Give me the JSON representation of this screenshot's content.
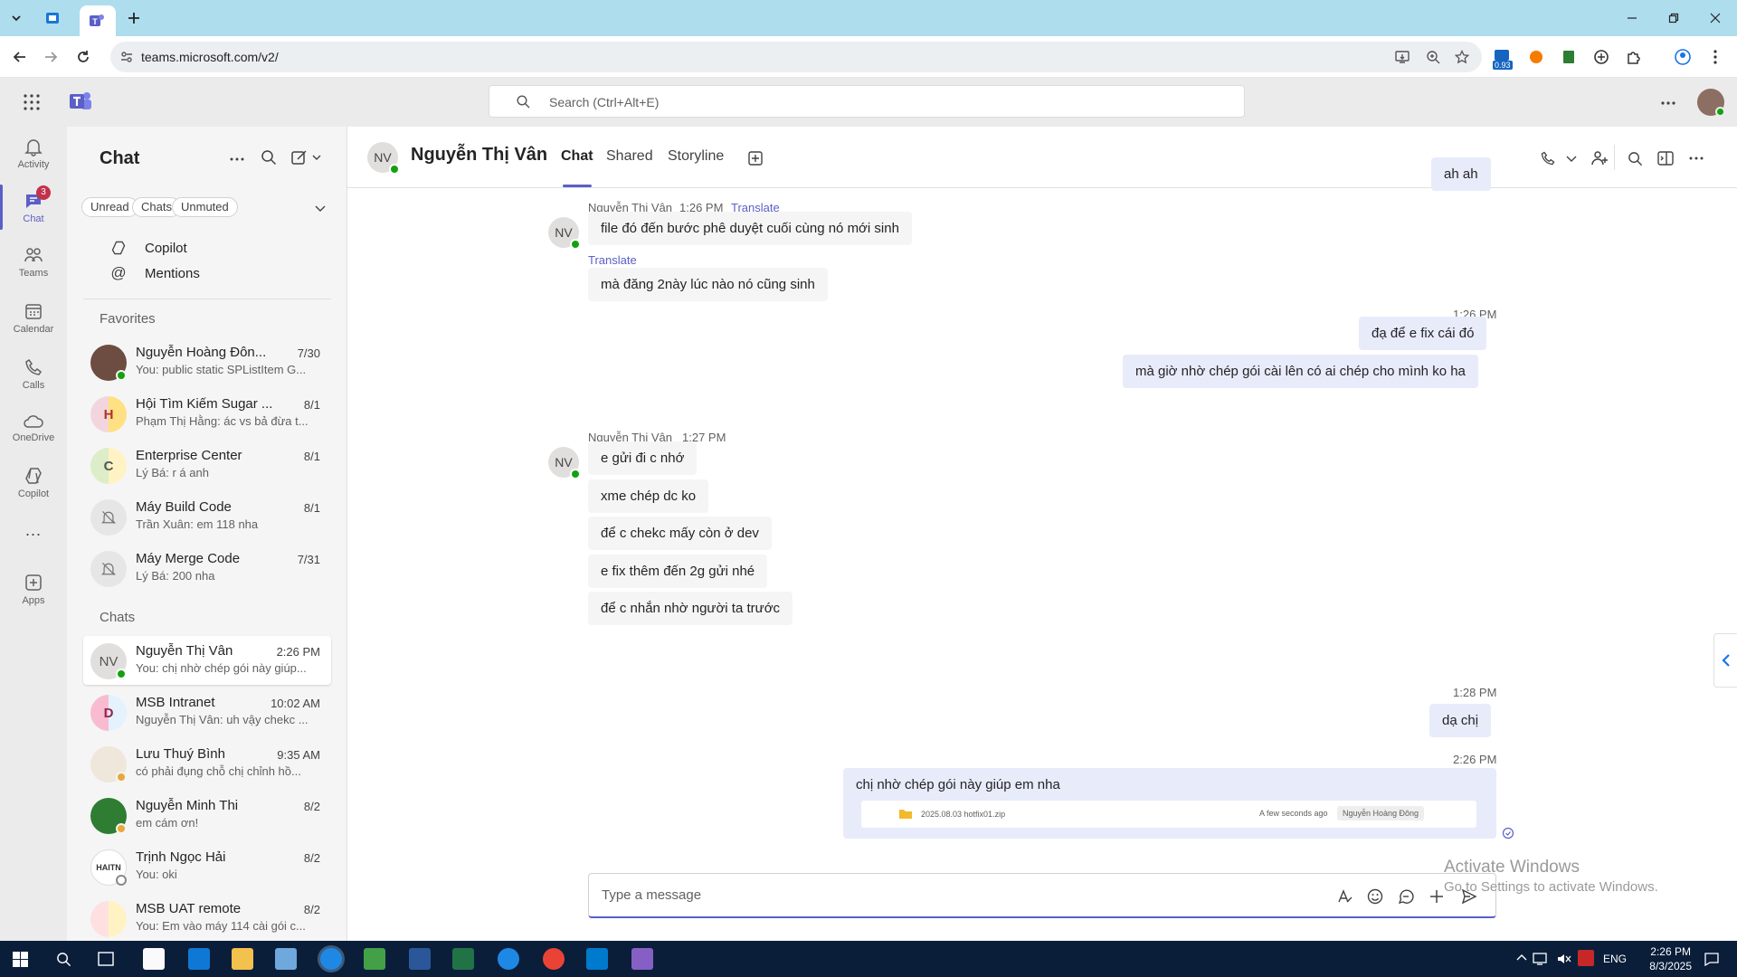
{
  "browser": {
    "url": "teams.microsoft.com/v2/",
    "ext_badge": "0.93"
  },
  "teams": {
    "search_placeholder": "Search (Ctrl+Alt+E)"
  },
  "rail": {
    "items": [
      {
        "label": "Activity",
        "icon": "bell-icon"
      },
      {
        "label": "Chat",
        "icon": "chat-icon",
        "badge": "3"
      },
      {
        "label": "Teams",
        "icon": "teams-icon"
      },
      {
        "label": "Calendar",
        "icon": "calendar-icon"
      },
      {
        "label": "Calls",
        "icon": "phone-icon"
      },
      {
        "label": "OneDrive",
        "icon": "cloud-icon"
      },
      {
        "label": "Copilot",
        "icon": "copilot-icon"
      },
      {
        "label": "...",
        "icon": "more-icon"
      },
      {
        "label": "Apps",
        "icon": "add-app-icon"
      }
    ]
  },
  "chat_list": {
    "title": "Chat",
    "filters": [
      "Unread",
      "Chats",
      "Unmuted"
    ],
    "nav": [
      {
        "label": "Copilot",
        "icon": "copilot-icon"
      },
      {
        "label": "Mentions",
        "icon": "at-icon"
      }
    ],
    "favorites_label": "Favorites",
    "favorites": [
      {
        "name": "Nguyễn Hoàng Đôn...",
        "preview": "You: public static SPListItem G...",
        "time": "7/30",
        "avatar": "",
        "status": "on"
      },
      {
        "name": "Hội Tìm Kiếm Sugar ...",
        "preview": "Phạm Thị Hằng: ác vs bả đừa t...",
        "time": "8/1",
        "avatar": "H",
        "status": ""
      },
      {
        "name": "Enterprise Center",
        "preview": "Lý Bá: r á anh",
        "time": "8/1",
        "avatar": "C",
        "status": ""
      },
      {
        "name": "Máy Build Code",
        "preview": "Trần Xuân: em 118 nha",
        "time": "8/1",
        "avatar": "",
        "status": ""
      },
      {
        "name": "Máy Merge Code",
        "preview": "Lý Bá: 200 nha",
        "time": "7/31",
        "avatar": "",
        "status": ""
      }
    ],
    "chats_label": "Chats",
    "chats": [
      {
        "name": "Nguyễn Thị Vân",
        "preview": "You: chị nhờ chép gói này giúp...",
        "time": "2:26 PM",
        "avatar": "NV",
        "status": "on"
      },
      {
        "name": "MSB Intranet",
        "preview": "Nguyễn Thị Vân: uh vậy chekc ...",
        "time": "10:02 AM",
        "avatar": "D",
        "status": ""
      },
      {
        "name": "Lưu Thuý Bình",
        "preview": "có phải đụng chỗ chị chỉnh hồ...",
        "time": "9:35 AM",
        "avatar": "",
        "status": "away"
      },
      {
        "name": "Nguyễn Minh Thi",
        "preview": "em cám ơn!",
        "time": "8/2",
        "avatar": "",
        "status": "away"
      },
      {
        "name": "Trịnh Ngọc Hải",
        "preview": "You: oki",
        "time": "8/2",
        "avatar": "HAITN",
        "status": "off"
      },
      {
        "name": "MSB UAT remote",
        "preview": "You: Em vào máy 114 cài gói c...",
        "time": "8/2",
        "avatar": "",
        "status": ""
      }
    ]
  },
  "conversation": {
    "avatar": "NV",
    "name": "Nguyễn Thị Vân",
    "tabs": [
      "Chat",
      "Shared",
      "Storyline"
    ],
    "messages": {
      "m0": "ah ah",
      "h1_sender": "Nguyễn Thị Vân",
      "h1_time": "1:26 PM",
      "translate": "Translate",
      "m1": "file đó đến bước phê duyệt cuối cùng nó mới sinh",
      "m2": "mà đăng 2này lúc nào nó cũng sinh",
      "h2_time": "1:26 PM",
      "m3": "đạ để e fix cái đó",
      "m4": "mà giờ nhờ chép gói cài lên có ai chép cho mình ko ha",
      "h3_sender": "Nguyễn Thị Vân",
      "h3_time": "1:27 PM",
      "m5": "e gửi đi c nhớ",
      "m6": "xme chép dc ko",
      "m7": "để c chekc mấy còn ở dev",
      "m8": "e fix thêm đến 2g gửi nhé",
      "m9": "để c nhắn nhờ người ta trước",
      "h4_time": "1:28 PM",
      "m10": "dạ chị",
      "h5_time": "2:26 PM",
      "m11": "chị nhờ chép gói này giúp em nha",
      "file_name": "2025.08.03 hotfix01.zip",
      "file_time": "A few seconds ago",
      "file_owner": "Nguyễn Hoàng Đông"
    },
    "compose_placeholder": "Type a message"
  },
  "watermark": {
    "line1": "Activate Windows",
    "line2": "Go to Settings to activate Windows."
  },
  "taskbar": {
    "lang": "ENG",
    "time": "2:26 PM",
    "date": "8/3/2025"
  },
  "colors": {
    "accent": "#5b5fc7",
    "online": "#13a10e",
    "outgoing_bubble": "#e8ebfa",
    "incoming_bubble": "#f5f5f5"
  }
}
